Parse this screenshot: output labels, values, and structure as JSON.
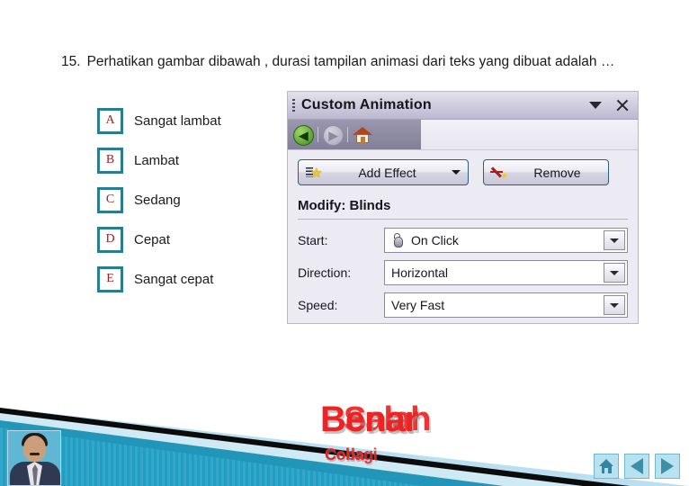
{
  "question": {
    "number": "15.",
    "text": "Perhatikan gambar dibawah , durasi tampilan animasi dari teks yang dibuat adalah …"
  },
  "options": [
    {
      "letter": "A",
      "label": "Sangat lambat"
    },
    {
      "letter": "B",
      "label": "Lambat"
    },
    {
      "letter": "C",
      "label": "Sedang"
    },
    {
      "letter": "D",
      "label": "Cepat"
    },
    {
      "letter": "E",
      "label": "Sangat cepat"
    }
  ],
  "task_pane": {
    "title": "Custom Animation",
    "icons": {
      "grip": "grip-dots-icon",
      "collapse": "chevron-down-icon",
      "close": "close-icon",
      "back": "back-arrow-icon",
      "forward": "forward-arrow-icon",
      "home": "home-icon"
    },
    "buttons": {
      "add_effect": "Add Effect",
      "add_effect_icon": "star-effect-icon",
      "remove": "Remove",
      "remove_icon": "remove-star-icon"
    },
    "modify_heading": "Modify: Blinds",
    "fields": [
      {
        "label": "Start:",
        "value": "On Click",
        "icon": "mouse-click-icon"
      },
      {
        "label": "Direction:",
        "value": "Horizontal",
        "icon": ""
      },
      {
        "label": "Speed:",
        "value": "Very Fast",
        "icon": ""
      }
    ]
  },
  "feedback": {
    "main_primary": "Benar",
    "main_secondary": "Salah",
    "sub_primary": "Coba",
    "sub_secondary": "lagi"
  },
  "navigation": [
    {
      "name": "home",
      "icon": "home-icon"
    },
    {
      "name": "previous",
      "icon": "triangle-left-icon"
    },
    {
      "name": "next",
      "icon": "triangle-right-icon"
    }
  ],
  "avatar": {
    "alt": "presenter-photo"
  },
  "colors": {
    "teal": "#2a7d91",
    "option_letter": "#9e2020",
    "feedback_red": "#ee2222",
    "nav_button": "#b8e2f0"
  }
}
